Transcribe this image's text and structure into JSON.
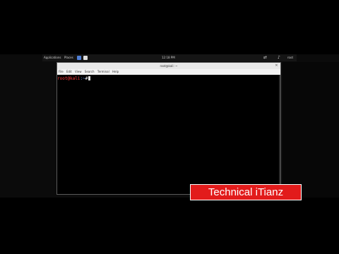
{
  "topbar": {
    "applications": "Applications",
    "places": "Places",
    "clock": "12:18 PM",
    "user": "root",
    "network_icon": "network-icon",
    "sound_icon": "sound-icon"
  },
  "window": {
    "title": "root@kali: ~",
    "menu": [
      "File",
      "Edit",
      "View",
      "Search",
      "Terminal",
      "Help"
    ]
  },
  "terminal": {
    "prompt_user": "root@kali",
    "prompt_path": ":~",
    "prompt_symbol": "#"
  },
  "watermark": {
    "text": "Technical iTianz"
  },
  "colors": {
    "prompt_user": "#ff3b3b",
    "prompt_path": "#6aa0ff",
    "watermark_bg": "#e21b1b"
  }
}
